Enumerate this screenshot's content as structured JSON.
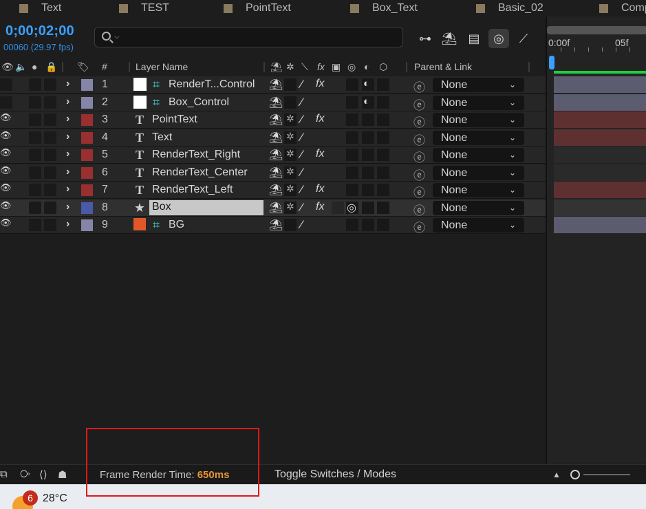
{
  "tabs": [
    {
      "label": "Text",
      "color": "#8a7a5f"
    },
    {
      "label": "TEST",
      "color": "#8a7a5f"
    },
    {
      "label": "PointText",
      "color": "#8a7a5f"
    },
    {
      "label": "Box_Text",
      "color": "#8a7a5f"
    },
    {
      "label": "Basic_02",
      "color": "#8a7a5f"
    },
    {
      "label": "Comp",
      "color": "#8a7a5f"
    }
  ],
  "timecode": "0;00;02;00",
  "frame_info": "00060 (29.97 fps)",
  "search": {
    "placeholder": "",
    "icon": "search-icon"
  },
  "header": {
    "hash": "#",
    "layer_name": "Layer Name",
    "parent_link": "Parent & Link",
    "fx": "fx"
  },
  "layers": [
    {
      "num": "1",
      "name": "RenderT...Control",
      "type": "null",
      "label_color": "#8585a8",
      "fx": true,
      "parent": "None"
    },
    {
      "num": "2",
      "name": "Box_Control",
      "type": "null",
      "label_color": "#8585a8",
      "fx": false,
      "parent": "None"
    },
    {
      "num": "3",
      "name": "PointText",
      "type": "text",
      "label_color": "#9a2f2f",
      "fx": true,
      "parent": "None"
    },
    {
      "num": "4",
      "name": "Text",
      "type": "text",
      "label_color": "#9a2f2f",
      "fx": false,
      "parent": "None"
    },
    {
      "num": "5",
      "name": "RenderText_Right",
      "type": "text",
      "label_color": "#9a2f2f",
      "fx": true,
      "parent": "None"
    },
    {
      "num": "6",
      "name": "RenderText_Center",
      "type": "text",
      "label_color": "#9a2f2f",
      "fx": false,
      "parent": "None"
    },
    {
      "num": "7",
      "name": "RenderText_Left",
      "type": "text",
      "label_color": "#9a2f2f",
      "fx": true,
      "parent": "None"
    },
    {
      "num": "8",
      "name": "Box",
      "type": "shape",
      "label_color": "#4a5aa8",
      "fx": true,
      "parent": "None",
      "selected": true
    },
    {
      "num": "9",
      "name": "BG",
      "type": "image",
      "label_color": "#8585a8",
      "fx": false,
      "parent": "None"
    }
  ],
  "timeline": {
    "start_label": "0:00f",
    "mark_label": "05f"
  },
  "bottom": {
    "frame_render_label": "Frame Render Time:",
    "frame_render_value": "650ms",
    "toggle_label": "Toggle Switches / Modes"
  },
  "taskbar": {
    "badge": "6",
    "temperature": "28°C"
  },
  "colors": {
    "accent": "#3aa0ff",
    "render_time": "#e8953a",
    "work_area": "#1fcf3f"
  }
}
